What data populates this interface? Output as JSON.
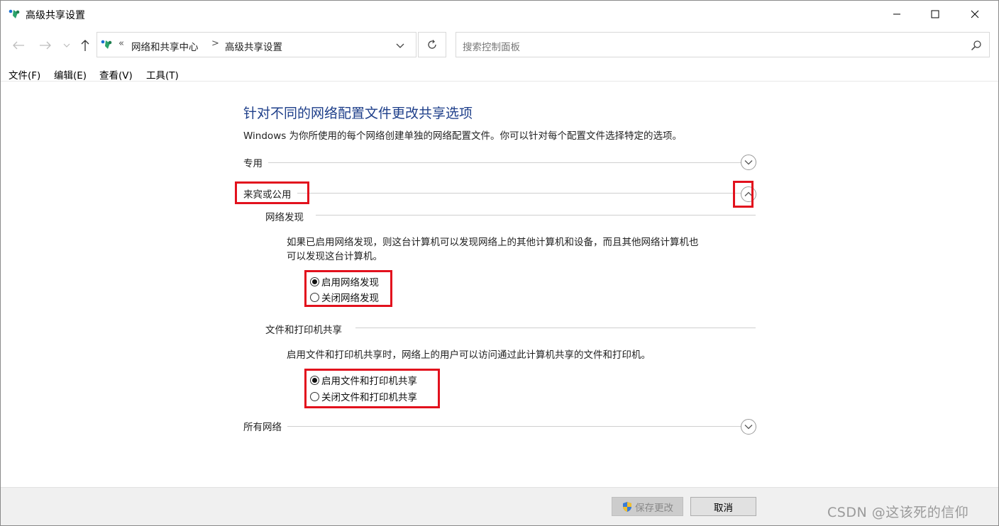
{
  "window": {
    "title": "高级共享设置",
    "icon": "network-sharing-icon"
  },
  "caption": {
    "minimize_icon": "minimize-icon",
    "maximize_icon": "maximize-icon",
    "close_icon": "close-icon"
  },
  "address": {
    "chevrons": "«",
    "crumbs": [
      "网络和共享中心",
      "高级共享设置"
    ],
    "separator": ">"
  },
  "search": {
    "placeholder": "搜索控制面板"
  },
  "menu": {
    "items": [
      "文件(F)",
      "编辑(E)",
      "查看(V)",
      "工具(T)"
    ]
  },
  "page": {
    "title": "针对不同的网络配置文件更改共享选项",
    "description": "Windows 为你所使用的每个网络创建单独的网络配置文件。你可以针对每个配置文件选择特定的选项。",
    "sections": {
      "private": {
        "label": "专用",
        "expanded": false
      },
      "guest_public": {
        "label": "来宾或公用",
        "expanded": true
      },
      "all_networks": {
        "label": "所有网络",
        "expanded": false
      }
    },
    "network_discovery": {
      "heading": "网络发现",
      "desc_line1": "如果已启用网络发现，则这台计算机可以发现网络上的其他计算机和设备，而且其他网络计算机也",
      "desc_line2": "可以发现这台计算机。",
      "options": [
        "启用网络发现",
        "关闭网络发现"
      ],
      "selected": 0
    },
    "file_printer_sharing": {
      "heading": "文件和打印机共享",
      "desc": "启用文件和打印机共享时，网络上的用户可以访问通过此计算机共享的文件和打印机。",
      "options": [
        "启用文件和打印机共享",
        "关闭文件和打印机共享"
      ],
      "selected": 0
    }
  },
  "footer": {
    "save_label": "保存更改",
    "cancel_label": "取消",
    "watermark": "CSDN @这该死的信仰"
  },
  "colors": {
    "title_blue": "#1e3f8a",
    "highlight_red": "#e2111d"
  }
}
